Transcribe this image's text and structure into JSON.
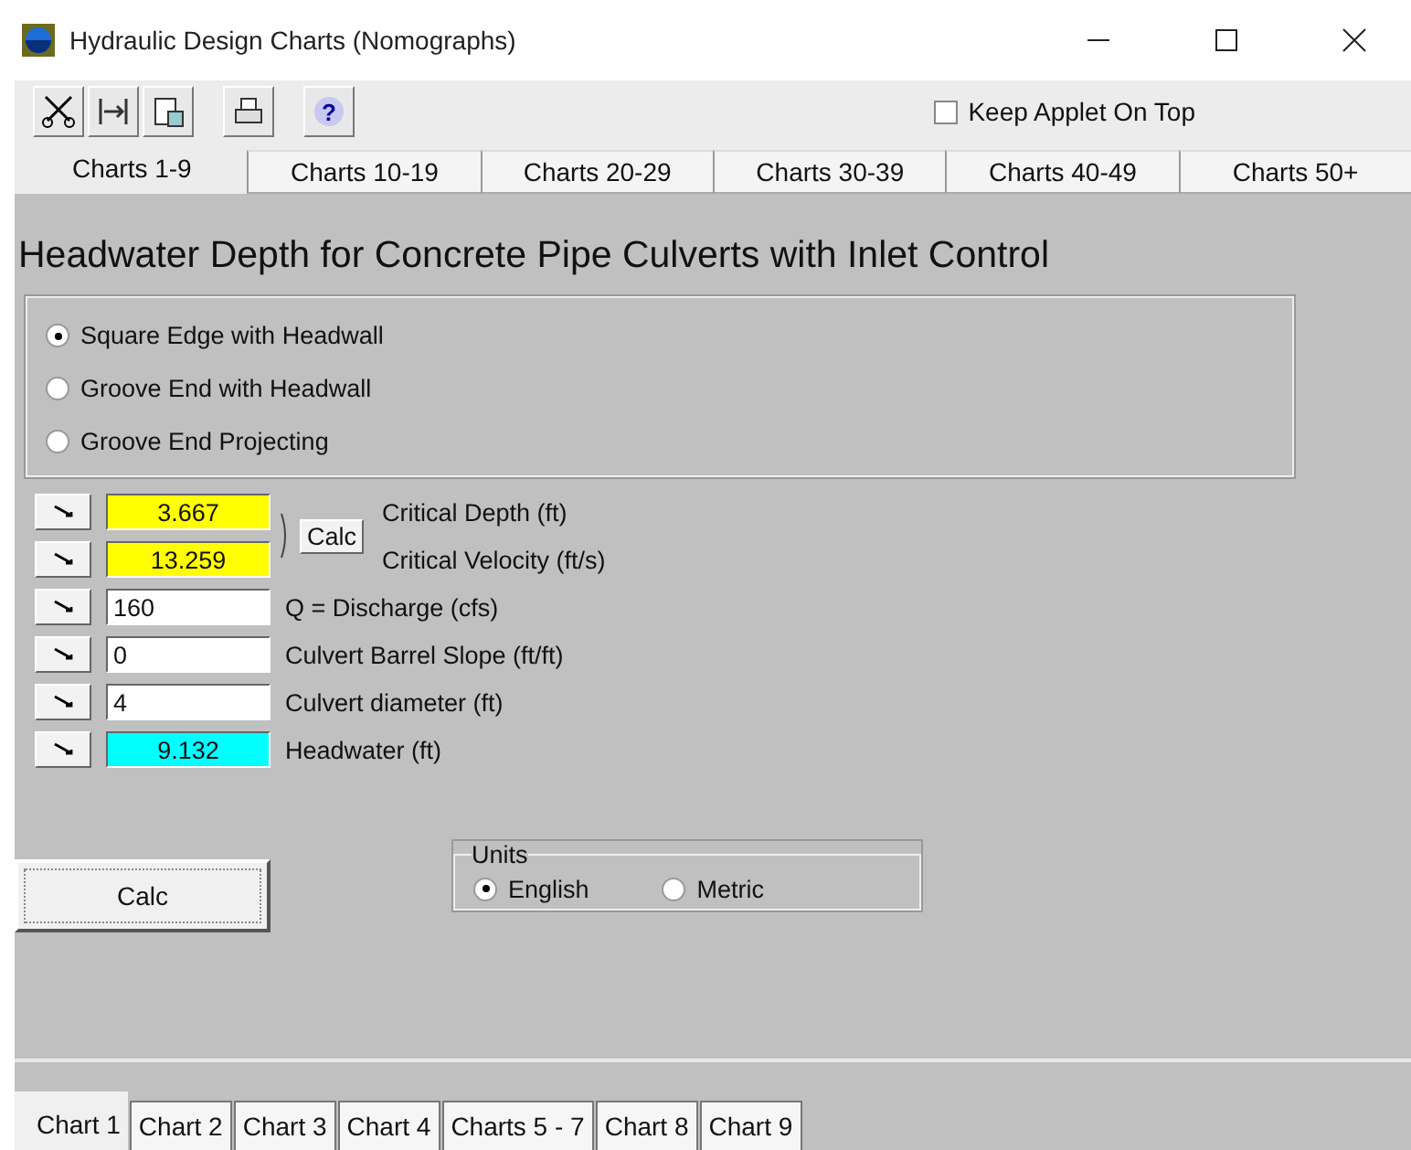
{
  "window": {
    "title": "Hydraulic Design Charts (Nomographs)"
  },
  "toolbar": {
    "help_glyph": "?",
    "keep_on_top": {
      "label": "Keep Applet On Top",
      "checked": false
    }
  },
  "chart_group_tabs": [
    {
      "label": "Charts 1-9",
      "selected": true
    },
    {
      "label": "Charts 10-19",
      "selected": false
    },
    {
      "label": "Charts 20-29",
      "selected": false
    },
    {
      "label": "Charts 30-39",
      "selected": false
    },
    {
      "label": "Charts 40-49",
      "selected": false
    },
    {
      "label": "Charts 50+",
      "selected": false
    }
  ],
  "heading": "Headwater Depth for Concrete Pipe Culverts with Inlet Control",
  "inlet_options": [
    {
      "label": "Square Edge with Headwall",
      "selected": true
    },
    {
      "label": "Groove End with Headwall",
      "selected": false
    },
    {
      "label": "Groove End Projecting",
      "selected": false
    }
  ],
  "critical": {
    "calc_button": "Calc",
    "rows": [
      {
        "value": "3.667",
        "label": "Critical Depth (ft)",
        "color": "#ffff00"
      },
      {
        "value": "13.259",
        "label": "Critical Velocity (ft/s)",
        "color": "#ffff00"
      }
    ]
  },
  "inputs": [
    {
      "value": "160",
      "label": "Q = Discharge (cfs)",
      "color": "#ffffff"
    },
    {
      "value": "0",
      "label": "Culvert Barrel Slope (ft/ft)",
      "color": "#ffffff"
    },
    {
      "value": "4",
      "label": "Culvert diameter (ft)",
      "color": "#ffffff"
    },
    {
      "value": "9.132",
      "label": "Headwater (ft)",
      "color": "#00ffff"
    }
  ],
  "calc_button": "Calc",
  "units": {
    "title": "Units",
    "options": [
      {
        "label": "English",
        "selected": true
      },
      {
        "label": "Metric",
        "selected": false
      }
    ]
  },
  "chart_tabs": [
    {
      "label": "Chart 1",
      "selected": true
    },
    {
      "label": "Chart 2",
      "selected": false
    },
    {
      "label": "Chart 3",
      "selected": false
    },
    {
      "label": "Chart 4",
      "selected": false
    },
    {
      "label": "Charts 5 - 7",
      "selected": false
    },
    {
      "label": "Chart 8",
      "selected": false
    },
    {
      "label": "Chart 9",
      "selected": false
    }
  ]
}
